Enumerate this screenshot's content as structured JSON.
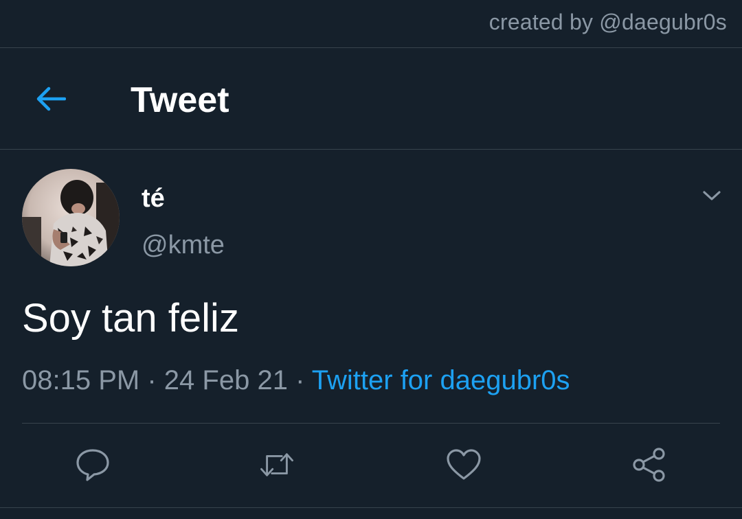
{
  "credit": "created by @daegubr0s",
  "header": {
    "title": "Tweet",
    "back_icon": "arrow-left-icon"
  },
  "tweet": {
    "display_name": "té",
    "handle": "@kmte",
    "text": "Soy tan feliz",
    "time": "08:15 PM",
    "separator": "·",
    "date": "24 Feb 21",
    "source": "Twitter for daegubr0s"
  },
  "actions": [
    "reply-icon",
    "retweet-icon",
    "like-icon",
    "share-icon"
  ],
  "colors": {
    "background": "#15202b",
    "accent": "#1da1f2",
    "muted": "#8b98a5",
    "divider": "#38444d"
  }
}
